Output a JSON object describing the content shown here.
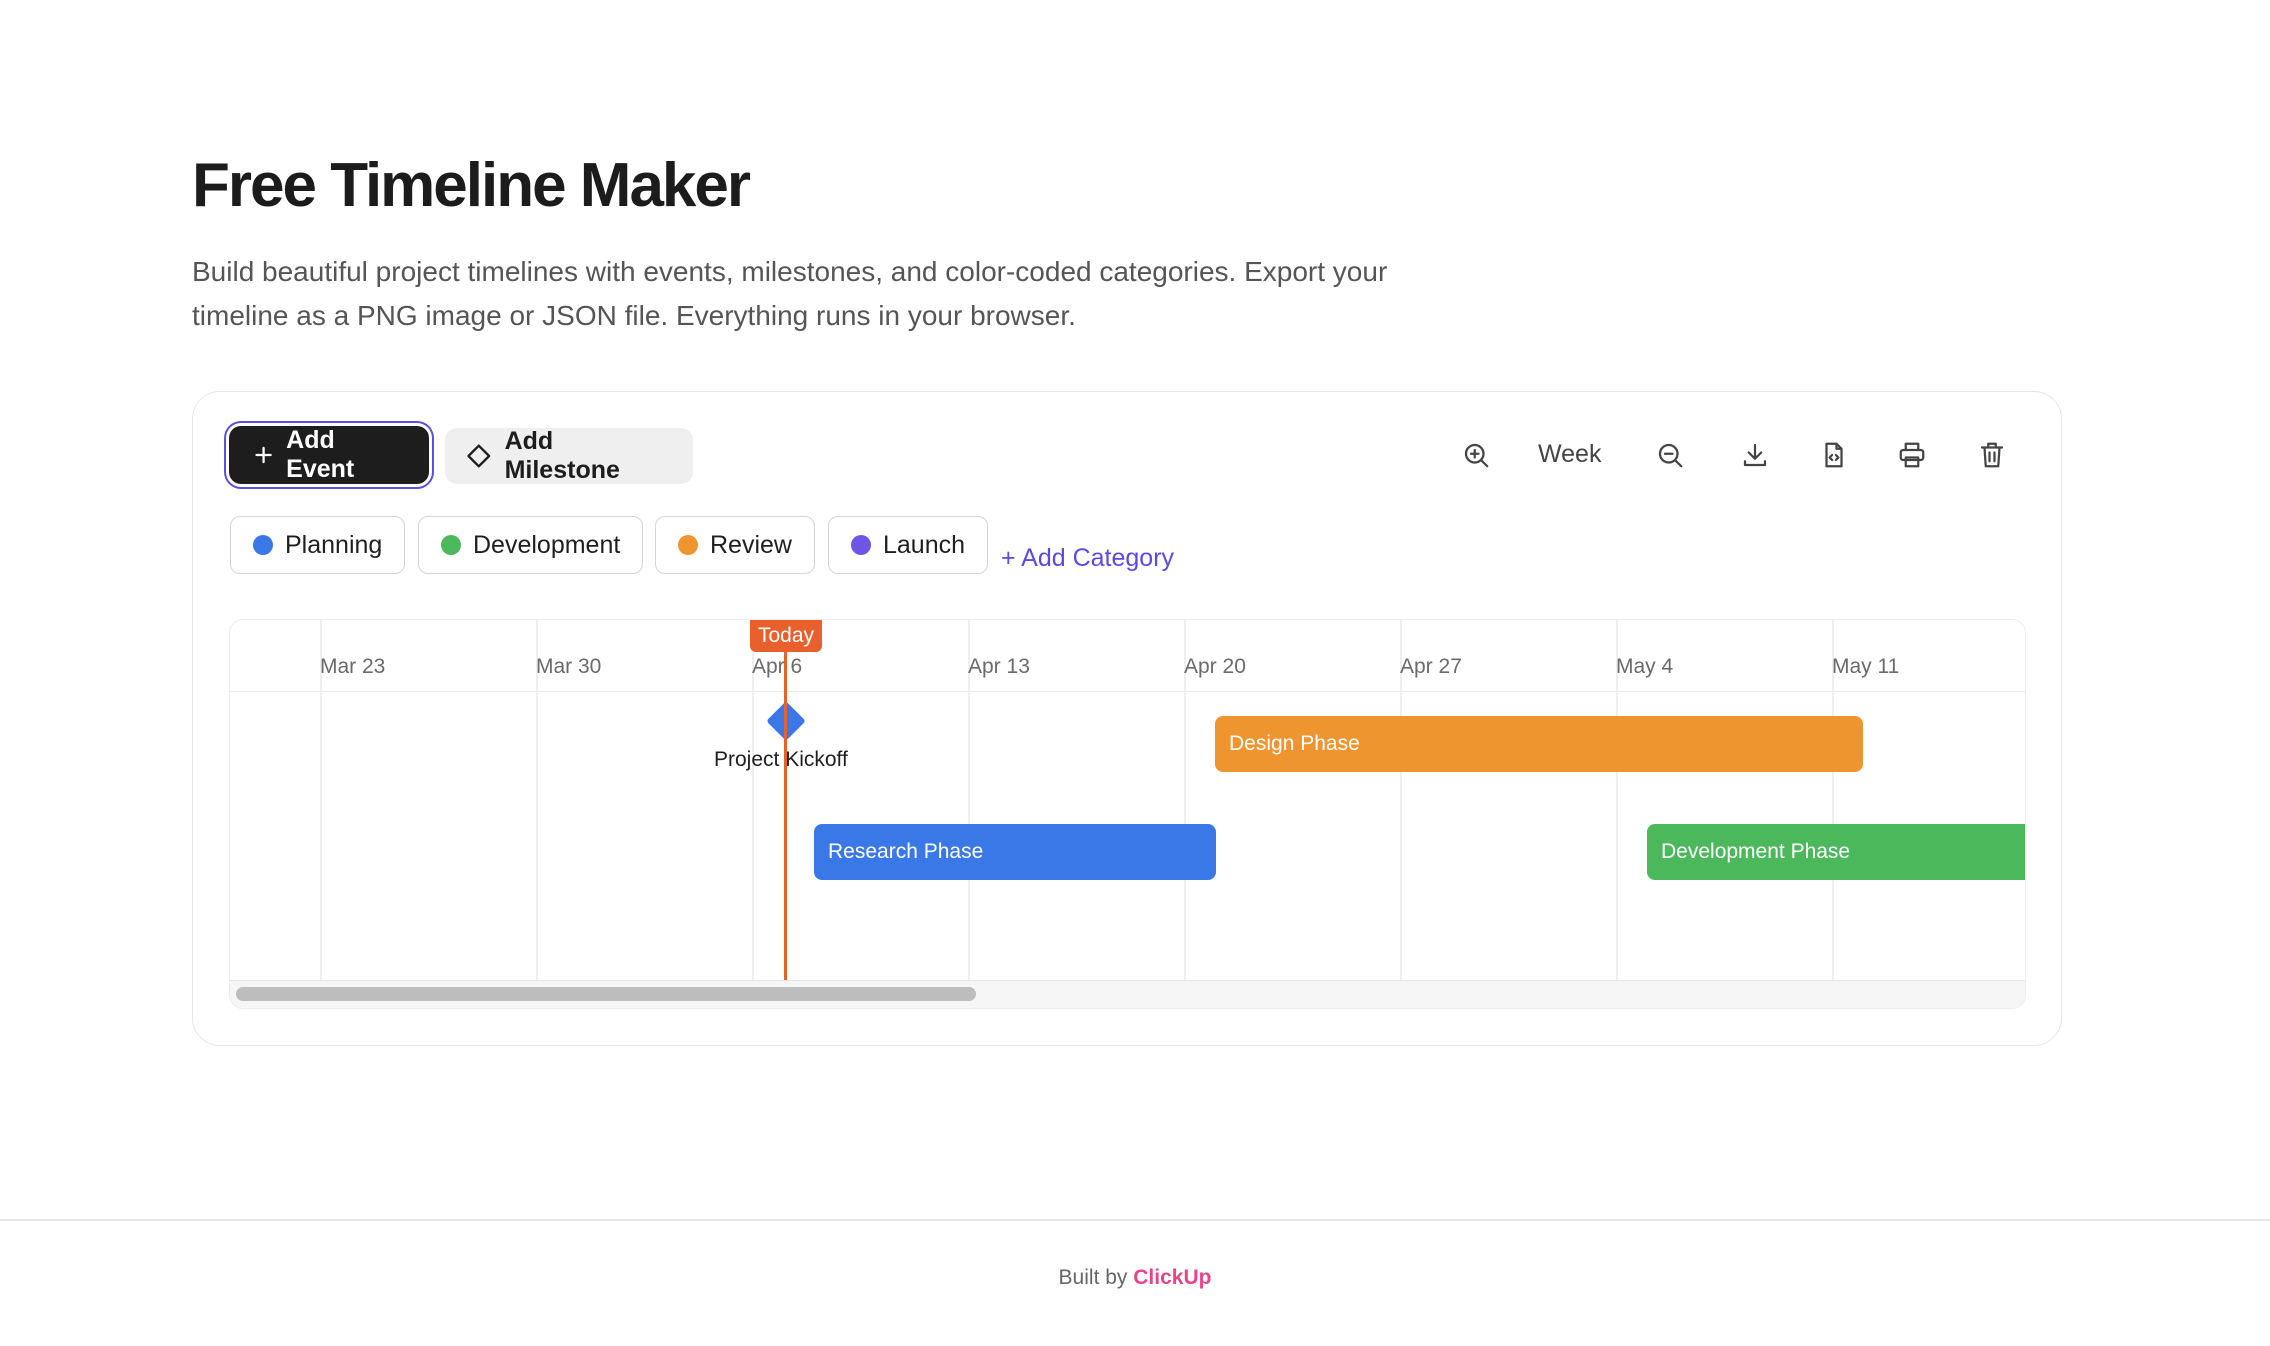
{
  "page": {
    "title": "Free Timeline Maker",
    "description": "Build beautiful project timelines with events, milestones, and color-coded categories. Export your timeline as a PNG image or JSON file. Everything runs in your browser."
  },
  "toolbar": {
    "add_event_label": "Add Event",
    "add_milestone_label": "Add Milestone",
    "zoom_level": "Week",
    "icons": [
      "zoom-in-icon",
      "zoom-out-icon",
      "download-icon",
      "file-code-icon",
      "printer-icon",
      "trash-icon"
    ]
  },
  "categories": [
    {
      "label": "Planning",
      "color": "#3b78e7"
    },
    {
      "label": "Development",
      "color": "#4cb85c"
    },
    {
      "label": "Review",
      "color": "#ee9530"
    },
    {
      "label": "Launch",
      "color": "#6f55e6"
    }
  ],
  "add_category_label": "+ Add Category",
  "timeline": {
    "ticks": [
      "Mar 23",
      "Mar 30",
      "Apr 6",
      "Apr 13",
      "Apr 20",
      "Apr 27",
      "May 4",
      "May 11"
    ],
    "today_label": "Today",
    "milestones": [
      {
        "label": "Project Kickoff",
        "color": "#3b78e7"
      }
    ],
    "events": [
      {
        "label": "Design Phase",
        "color": "#ee9530"
      },
      {
        "label": "Research Phase",
        "color": "#3b78e7"
      },
      {
        "label": "Development Phase",
        "color": "#4cb85c"
      }
    ]
  },
  "footer": {
    "prefix": "Built by",
    "brand": "ClickUp"
  }
}
